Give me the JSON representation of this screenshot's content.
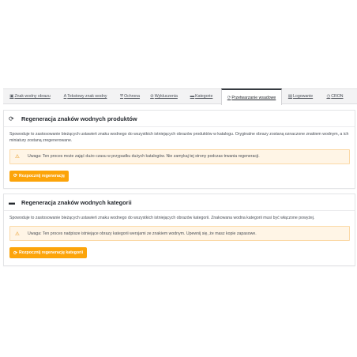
{
  "tabs": [
    {
      "icon": "▣",
      "label": "Znak wodny obrazu"
    },
    {
      "icon": "A",
      "label": "Tekstowy znak wodny"
    },
    {
      "icon": "⛨",
      "label": "Ochrona"
    },
    {
      "icon": "⊘",
      "label": "Wykluczenia"
    },
    {
      "icon": "▬",
      "label": "Kategorie"
    },
    {
      "icon": "⟳",
      "label": "Przetwarzanie wsadowe"
    },
    {
      "icon": "▤",
      "label": "Logowanie"
    },
    {
      "icon": "◷",
      "label": "CRON"
    }
  ],
  "active_tab": "Przetwarzanie wsadowe",
  "products_panel": {
    "icon": "⟳",
    "title": "Regeneracja znaków wodnych produktów",
    "description": "Spowoduje to zastosowanie bieżących ustawień znaku wodnego do wszystkich istniejących obrazów produktów w katalogu. Oryginalne obrazy zostaną oznaczone znakiem wodnym, a ich miniatury zostaną zregenerowane.",
    "warning": "Uwaga: Ten proces może zająć dużo czasu w przypadku dużych katalogów. Nie zamykaj tej strony podczas trwania regeneracji.",
    "button_icon": "⟳",
    "button_label": "Rozpocznij regenerację"
  },
  "categories_panel": {
    "icon": "▬",
    "title": "Regeneracja znaków wodnych kategorii",
    "description": "Spowoduje to zastosowanie bieżących ustawień znaku wodnego do wszystkich istniejących obrazów kategorii. Znakowana wodna kategorii musi być włączone powyżej.",
    "warning": "Uwaga: Ten proces nadpisze istniejące obrazy kategorii wersjami ze znakiem wodnym. Upewnij się, że masz kopie zapasowe.",
    "button_icon": "⟳",
    "button_label": "Rozpocznij regenerację kategorii"
  },
  "colors": {
    "accent_button": "#fca40a",
    "warning_bg": "#fff5e6",
    "warning_border": "#fbd9a7",
    "warning_icon": "#e58e0c",
    "active_tab_border": "#363a41"
  }
}
